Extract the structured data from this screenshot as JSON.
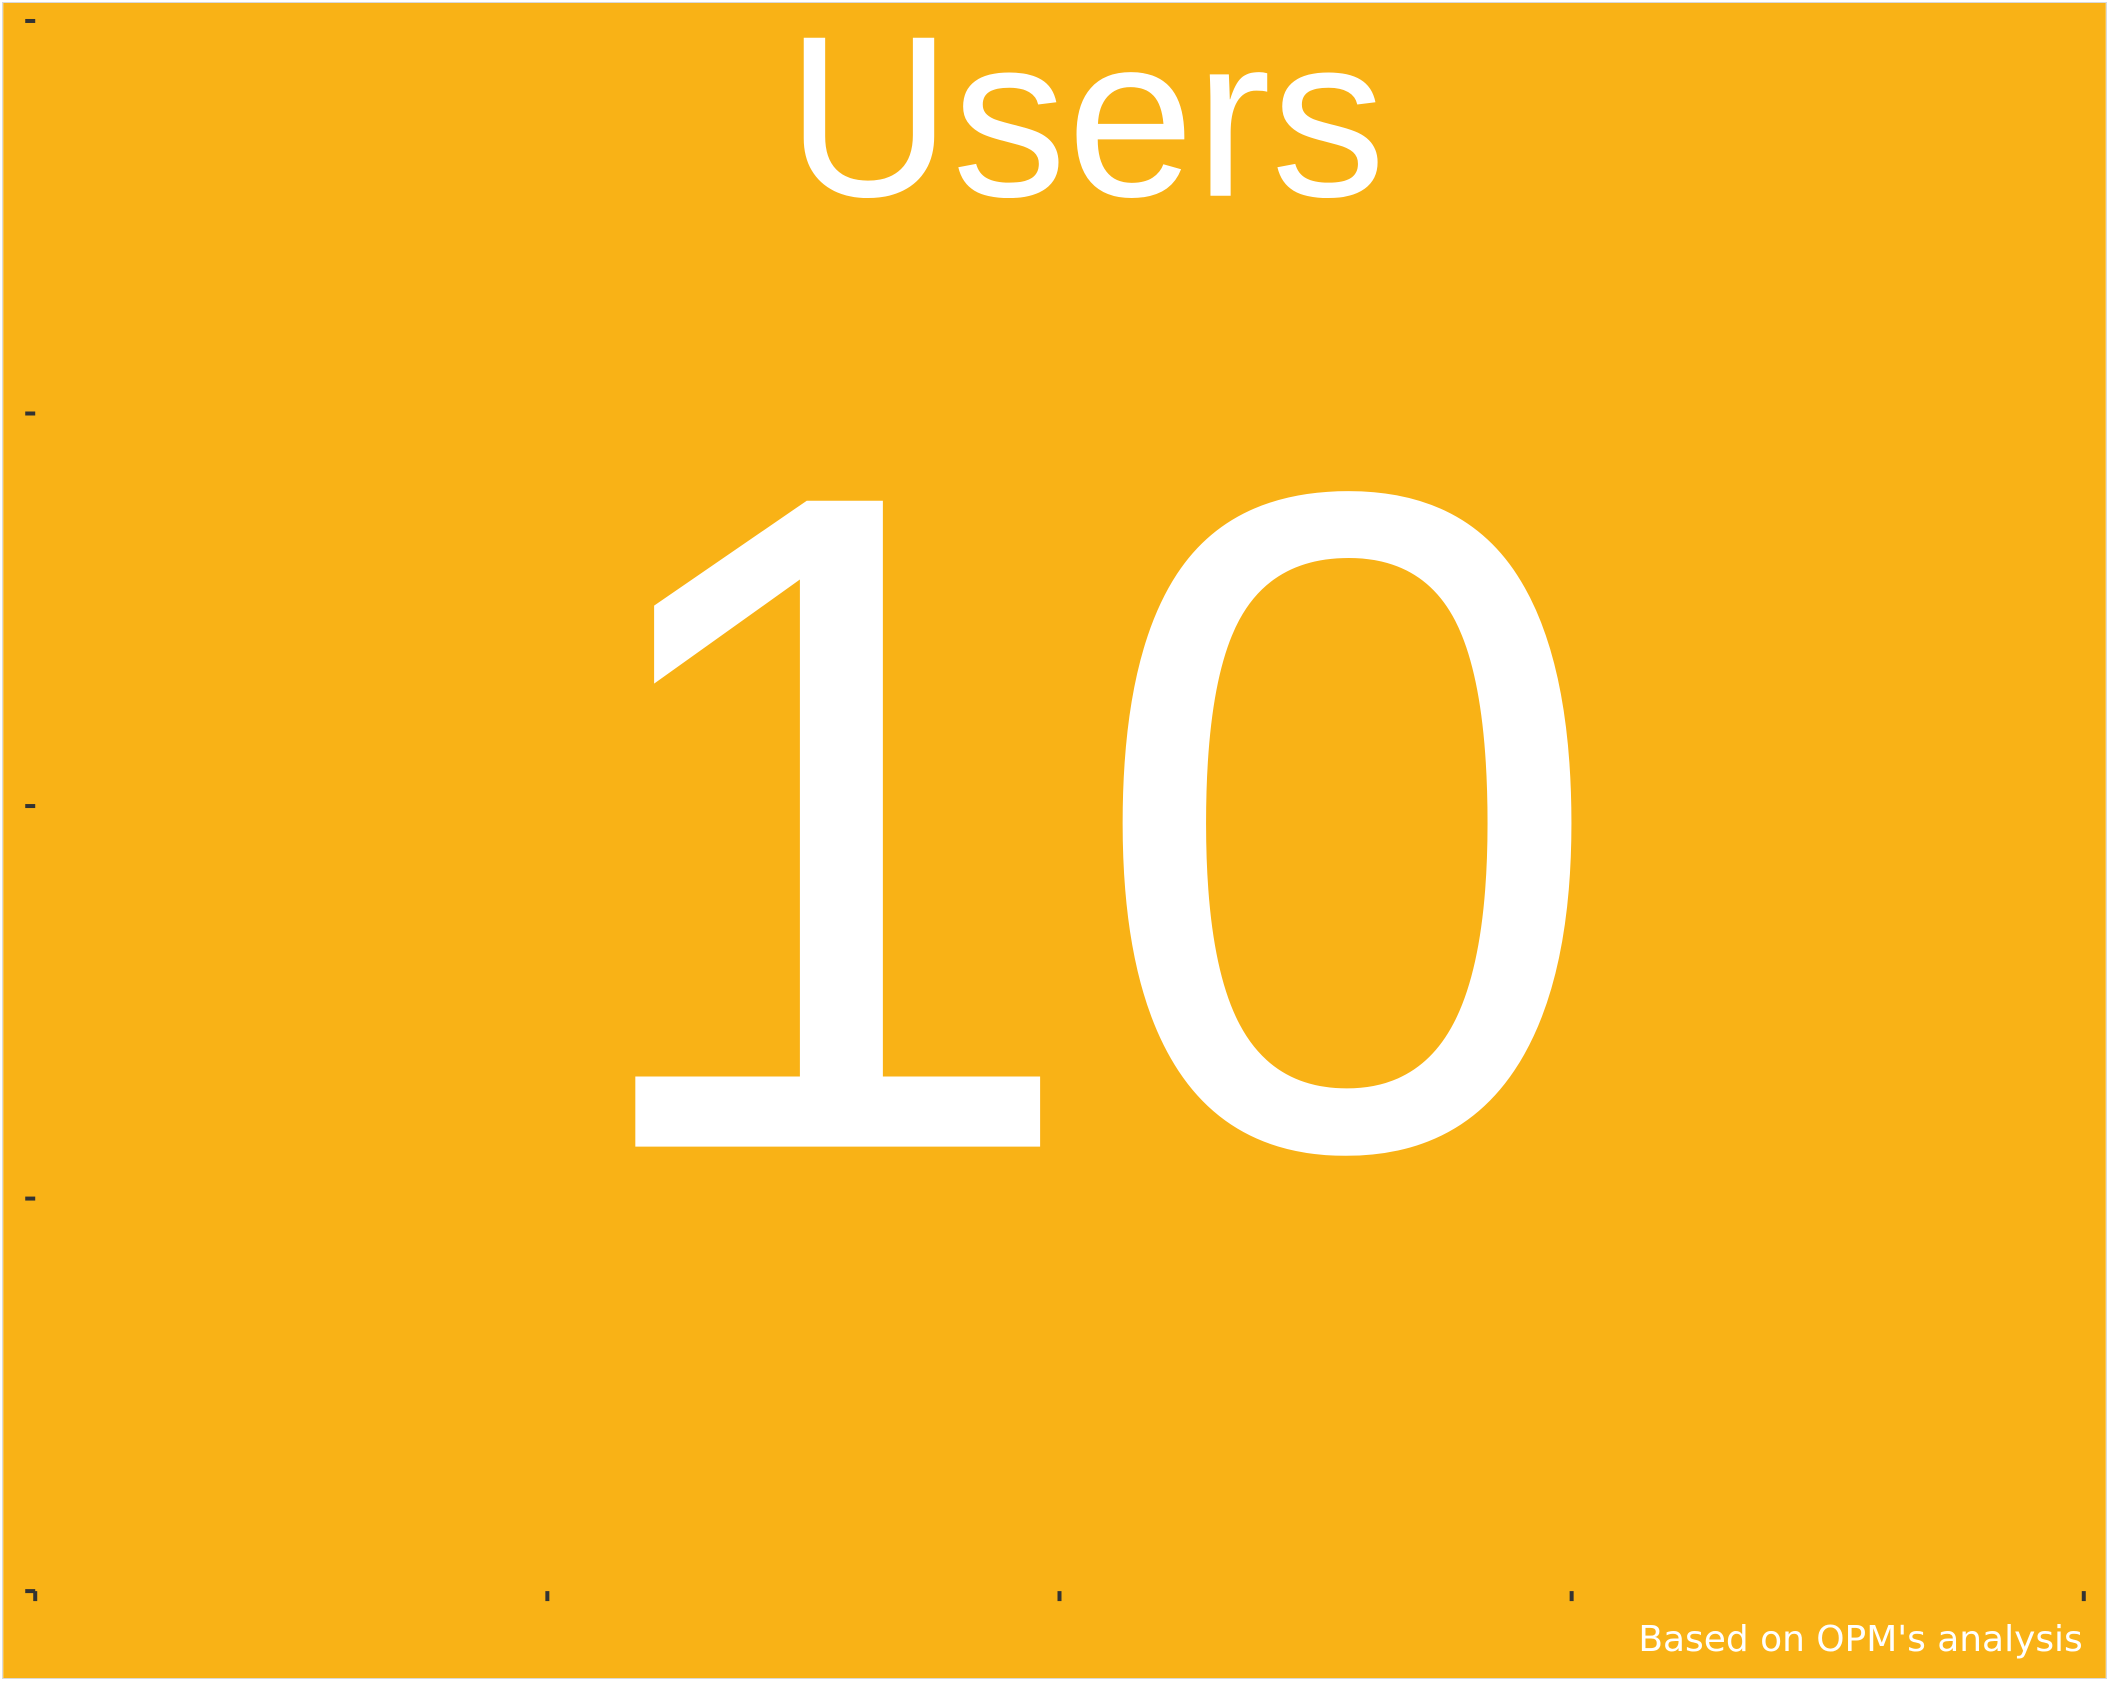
{
  "chart_data": {
    "type": "kpi",
    "title": "Users",
    "value": "10",
    "footnote": "Based on OPM's analysis",
    "background_color": "#F9B216",
    "text_color": "#FFFFFF",
    "tick_color": "#333333",
    "y_ticks": 5,
    "x_ticks": 5
  }
}
